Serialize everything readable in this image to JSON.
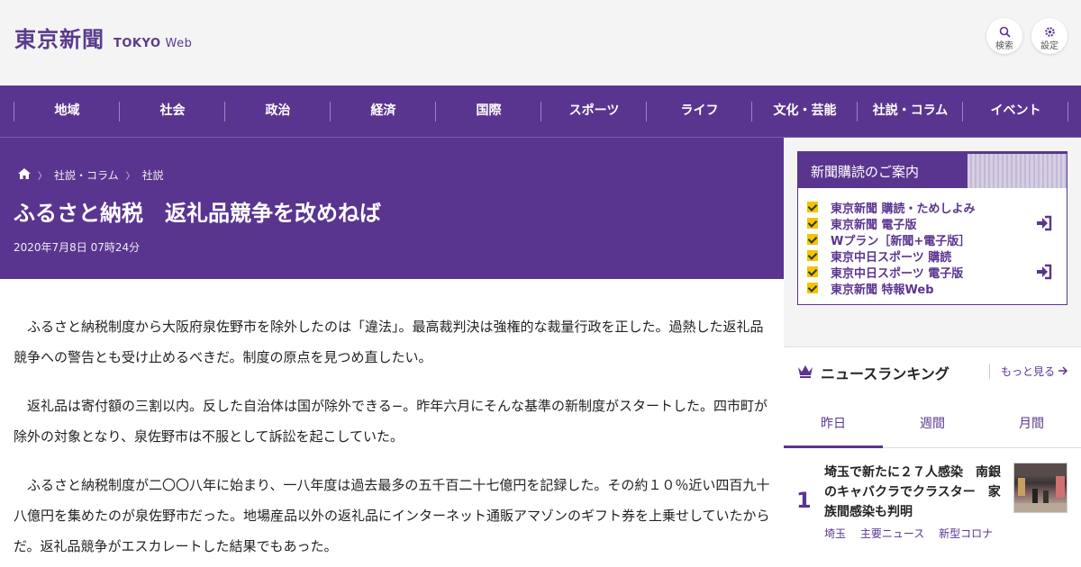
{
  "header": {
    "logo_jp": "東京新聞",
    "logo_en_bold": "TOKYO",
    "logo_en_light": "Web",
    "search_label": "検索",
    "settings_label": "設定"
  },
  "nav": {
    "items": [
      "地域",
      "社会",
      "政治",
      "経済",
      "国際",
      "スポーツ",
      "ライフ",
      "文化・芸能",
      "社説・コラム",
      "イベント"
    ]
  },
  "article": {
    "breadcrumb": [
      "社説・コラム",
      "社説"
    ],
    "title": "ふるさと納税　返礼品競争を改めねば",
    "date": "2020年7月8日 07時24分",
    "paragraphs": [
      "ふるさと納税制度から大阪府泉佐野市を除外したのは「違法」。最高裁判決は強権的な裁量行政を正した。過熱した返礼品競争への警告とも受け止めるべきだ。制度の原点を見つめ直したい。",
      "返礼品は寄付額の三割以内。反した自治体は国が除外できる−。昨年六月にそんな基準の新制度がスタートした。四市町が除外の対象となり、泉佐野市は不服として訴訟を起こしていた。",
      "ふるさと納税制度が二〇〇八年に始まり、一八年度は過去最多の五千百二十七億円を記録した。その約１０％近い四百九十八億円を集めたのが泉佐野市だった。地場産品以外の返礼品にインターネット通販アマゾンのギフト券を上乗せしていたからだ。返礼品競争がエスカレートした結果でもあった。"
    ]
  },
  "subscription": {
    "heading": "新聞購読のご案内",
    "items": [
      {
        "label": "東京新聞 購読・ためしよみ",
        "login": false
      },
      {
        "label": "東京新聞 電子版",
        "login": true
      },
      {
        "label": "Wプラン［新聞+電子版］",
        "login": false
      },
      {
        "label": "東京中日スポーツ 購読",
        "login": false
      },
      {
        "label": "東京中日スポーツ 電子版",
        "login": true
      },
      {
        "label": "東京新聞 特報Web",
        "login": false
      }
    ]
  },
  "ranking": {
    "heading": "ニュースランキング",
    "more_label": "もっと見る",
    "tabs": [
      "昨日",
      "週間",
      "月間"
    ],
    "active_tab": 0,
    "items": [
      {
        "rank": "1",
        "title": "埼玉で新たに２７人感染　南銀のキャバクラでクラスター　家族間感染も判明",
        "tags": [
          "埼玉",
          "主要ニュース",
          "新型コロナ"
        ]
      }
    ]
  },
  "colors": {
    "brand_purple": "#5a3590",
    "check_yellow": "#f2c400"
  }
}
